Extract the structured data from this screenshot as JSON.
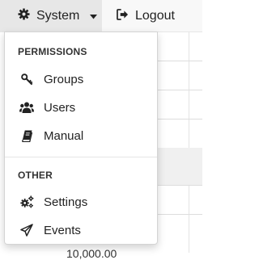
{
  "navbar": {
    "system_label": "System",
    "logout_label": "Logout"
  },
  "menu": {
    "permissions_header": "PERMISSIONS",
    "groups_label": "Groups",
    "users_label": "Users",
    "manual_label": "Manual",
    "other_header": "OTHER",
    "settings_label": "Settings",
    "events_label": "Events"
  },
  "background": {
    "partial_value": "10,000.00"
  }
}
